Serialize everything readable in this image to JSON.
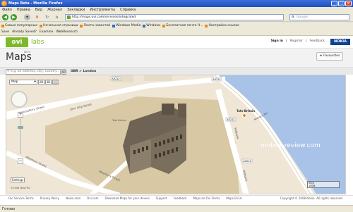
{
  "window": {
    "title": "Maps Beta - Mozilla Firefox"
  },
  "menu": [
    "Файл",
    "Правка",
    "Вид",
    "Журнал",
    "Закладки",
    "Инструменты",
    "Справка"
  ],
  "nav": {
    "url": "http://maps.ovi.com/services/integrated",
    "search_placeholder": "Google"
  },
  "bookmarks": [
    "Самые популярные",
    "Начальная страница",
    "Лента новостей",
    "Windows Media",
    "Windows",
    "Бесплатная почта H...",
    "Настройка ссылок"
  ],
  "toolbar2": [
    "Save",
    "Already Saved?",
    "Examine",
    "WebResearch"
  ],
  "ovi": {
    "logo": "ovi",
    "labs": "labs",
    "sign_in": "Sign in",
    "register": "Register",
    "feedback": "Feedback",
    "nokia": "NOKIA"
  },
  "maps": {
    "title": "Maps",
    "beta": "BETA",
    "favourites": "Favourites"
  },
  "search": {
    "placeholder": "e.g. an address, city, country...",
    "go": "go",
    "breadcrumb": "GBR > London"
  },
  "map": {
    "view_select": "Map",
    "btn_2d": "2D",
    "btn_3d": "3D",
    "btn_pov": "POV",
    "settings": "Settings",
    "copyright": "©2008 NAVTEQ",
    "scale_top": "50m",
    "scale_bottom": "100ft",
    "labels": {
      "street1": "Horseferry Street",
      "street2": "John Islip Street",
      "street3": "Atterbury Street",
      "street4": "Atterbury Street",
      "street5": "Millbank",
      "street6": "Millbank",
      "poi": "Tate Britain",
      "poi2": "Tate Britain",
      "poi3": "Millbank Mil.."
    },
    "road_shields": [
      "A3212",
      "A3212",
      "A3212",
      "A3212"
    ]
  },
  "watermark": "mobile-review.com",
  "footer": [
    "Ovi Service Terms",
    "Privacy Policy",
    "Nokia.com",
    "Ovi.com",
    "Download Maps for your device",
    "Support",
    "Feedback",
    "Maps on Ovi Terms",
    "Maps EULA"
  ],
  "footer_copyright": "Copyright © 2008 Nokia. All rights reserved.",
  "status": "Готово"
}
